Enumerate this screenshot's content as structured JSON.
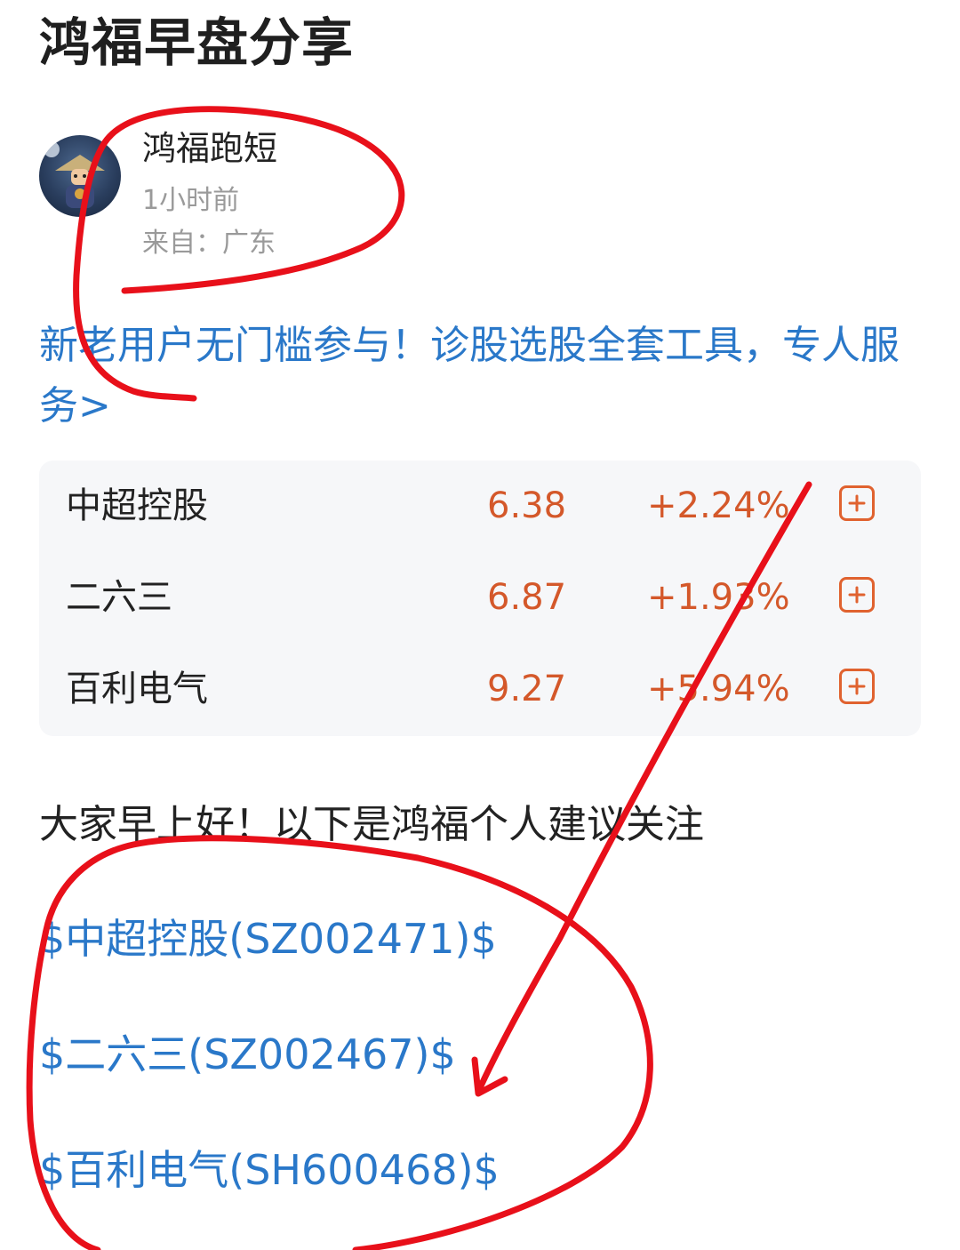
{
  "post": {
    "title": "鸿福早盘分享",
    "author": "鸿福跑短",
    "time": "1小时前",
    "location": "来自：广东",
    "promo_link": "新老用户无门槛参与！诊股选股全套工具，专人服务>",
    "greeting": "大家早上好！以下是鸿福个人建议关注"
  },
  "stocks": [
    {
      "name": "中超控股",
      "price": "6.38",
      "change": "+2.24%"
    },
    {
      "name": "二六三",
      "price": "6.87",
      "change": "+1.93%"
    },
    {
      "name": "百利电气",
      "price": "9.27",
      "change": "+5.94%"
    }
  ],
  "stock_tags": [
    "$中超控股(SZ002471)$",
    "$二六三(SZ002467)$",
    "$百利电气(SH600468)$"
  ],
  "colors": {
    "link": "#2a78c9",
    "up": "#d4582a",
    "annotation": "#e8101a"
  },
  "icons": {
    "add": "plus-square-icon"
  }
}
